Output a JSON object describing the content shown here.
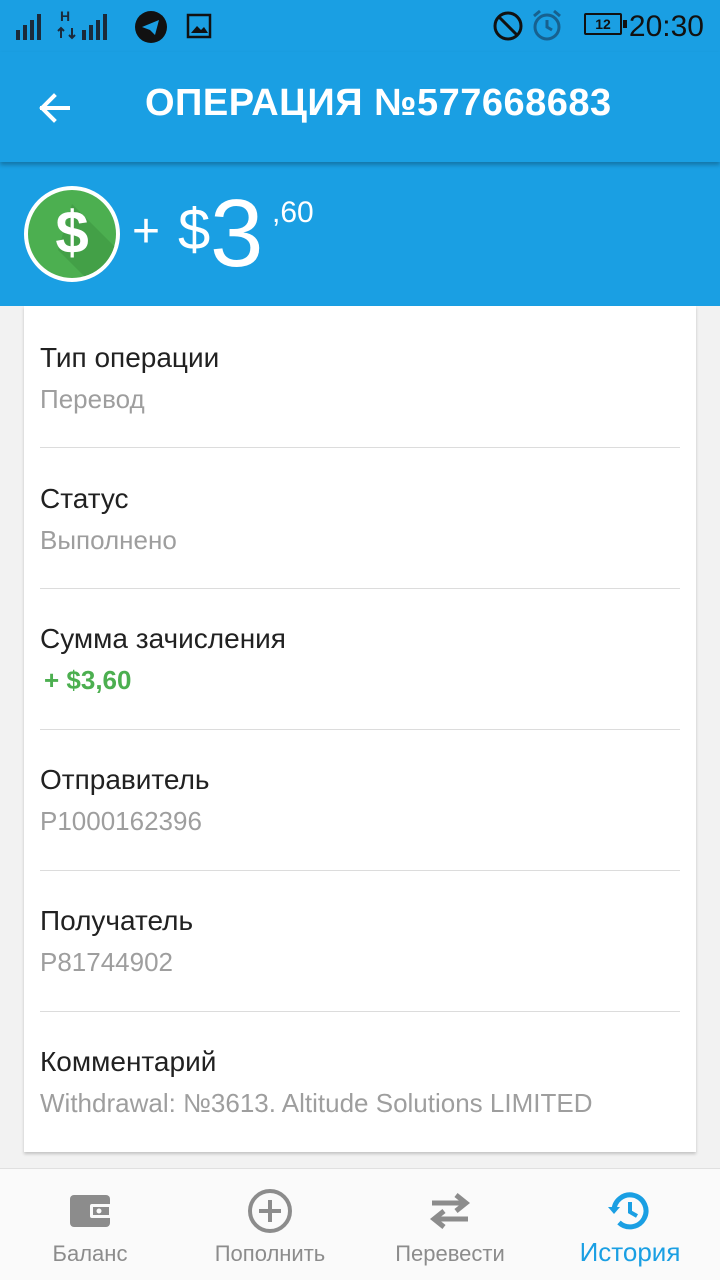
{
  "status_bar": {
    "time": "20:30",
    "network_type": "H",
    "battery_level": "12",
    "icons": [
      "signal-icon",
      "telegram-icon",
      "image-icon",
      "do-not-disturb-icon",
      "alarm-icon",
      "battery-icon"
    ]
  },
  "app_bar": {
    "title": "ОПЕРАЦИЯ №577668683",
    "back_icon": "arrow-back-icon"
  },
  "amount": {
    "sign": "+",
    "currency": "$",
    "main": "3",
    "cents": ",60",
    "icon": "dollar-coin-icon"
  },
  "details": [
    {
      "label": "Тип операции",
      "value": "Перевод"
    },
    {
      "label": "Статус",
      "value": "Выполнено"
    },
    {
      "label": "Сумма зачисления",
      "value": "+ $3,60"
    },
    {
      "label": "Отправитель",
      "value": "P1000162396"
    },
    {
      "label": "Получатель",
      "value": "P81744902"
    },
    {
      "label": "Комментарий",
      "value": "Withdrawal: №3613. Altitude Solutions LIMITED"
    }
  ],
  "bottom_nav": {
    "items": [
      {
        "label": "Баланс",
        "icon": "wallet-icon"
      },
      {
        "label": "Пополнить",
        "icon": "add-circle-icon"
      },
      {
        "label": "Перевести",
        "icon": "swap-arrows-icon"
      },
      {
        "label": "История",
        "icon": "history-icon",
        "active": true
      }
    ]
  },
  "colors": {
    "primary": "#1a9fe3",
    "positive": "#4caf50",
    "label": "#212121",
    "secondary_text": "#9e9e9e",
    "nav_inactive": "#8c8c8c"
  }
}
